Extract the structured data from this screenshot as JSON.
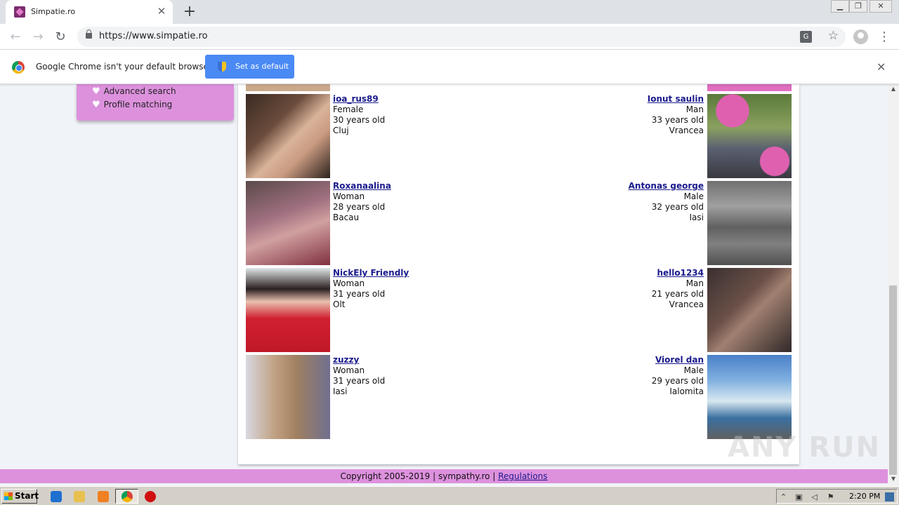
{
  "browser": {
    "tab_title": "Simpatie.ro",
    "url": "https://www.simpatie.ro",
    "infobar_text": "Google Chrome isn't your default browser",
    "set_default_label": "Set as default"
  },
  "sidebar": {
    "links": [
      {
        "label": "Advanced search"
      },
      {
        "label": "Profile matching"
      }
    ]
  },
  "profiles": {
    "left": [
      {
        "name": "ioa_rus89",
        "gender": "Female",
        "age": "30 years old",
        "city": "Cluj"
      },
      {
        "name": "Roxanaalina",
        "gender": "Woman",
        "age": "28 years old",
        "city": "Bacau"
      },
      {
        "name": "NickEly Friendly",
        "gender": "Woman",
        "age": "31 years old",
        "city": "Olt"
      },
      {
        "name": "zuzzy",
        "gender": "Woman",
        "age": "31 years old",
        "city": "Iasi"
      }
    ],
    "right": [
      {
        "name": "Ionut saulin",
        "gender": "Man",
        "age": "33 years old",
        "city": "Vrancea"
      },
      {
        "name": "Antonas george",
        "gender": "Male",
        "age": "32 years old",
        "city": "Iasi"
      },
      {
        "name": "hello1234",
        "gender": "Man",
        "age": "21 years old",
        "city": "Vrancea"
      },
      {
        "name": "Viorel dan",
        "gender": "Male",
        "age": "29 years old",
        "city": "Ialomita"
      }
    ]
  },
  "footer": {
    "copyright": "Copyright 2005-2019 | sympathy.ro |",
    "regulations_label": "Regulations"
  },
  "watermark": "ANY RUN",
  "taskbar": {
    "start_label": "Start",
    "clock": "2:20 PM"
  },
  "colors": {
    "accent_pink": "#dd91dd",
    "link_blue": "#1a1a8c",
    "chrome_blue": "#4a8af4"
  }
}
